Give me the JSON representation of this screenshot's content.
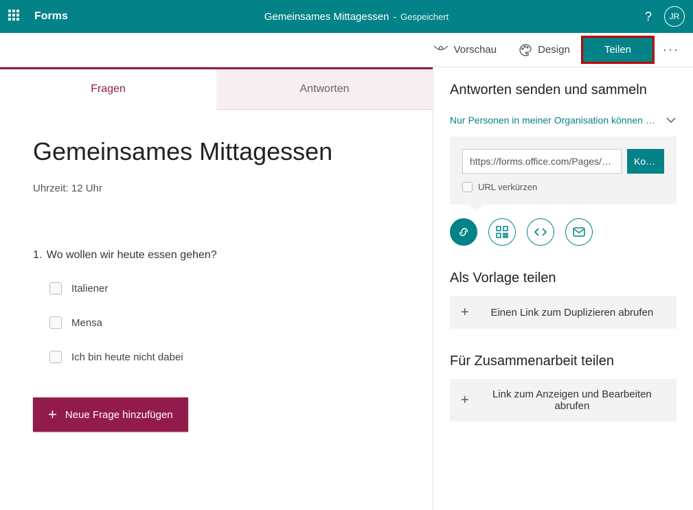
{
  "header": {
    "app_name": "Forms",
    "form_name": "Gemeinsames Mittagessen",
    "save_status": "Gespeichert",
    "user_initials": "JR"
  },
  "commands": {
    "preview": "Vorschau",
    "design": "Design",
    "share": "Teilen"
  },
  "tabs": {
    "questions": "Fragen",
    "responses": "Antworten"
  },
  "form": {
    "title": "Gemeinsames Mittagessen",
    "subtitle": "Uhrzeit: 12 Uhr",
    "questions": [
      {
        "number": "1.",
        "text": "Wo wollen wir heute essen gehen?",
        "options": [
          "Italiener",
          "Mensa",
          "Ich bin heute nicht dabei"
        ]
      }
    ],
    "add_button": "Neue Frage hinzufügen"
  },
  "share_panel": {
    "heading": "Antworten senden und sammeln",
    "audience": "Nur Personen in meiner Organisation können ant...",
    "link_value": "https://forms.office.com/Pages/Respon",
    "copy_label": "Kopie...",
    "shorten_label": "URL verkürzen",
    "template_heading": "Als Vorlage teilen",
    "template_button": "Einen Link zum Duplizieren abrufen",
    "collab_heading": "Für Zusammenarbeit teilen",
    "collab_button": "Link zum Anzeigen und Bearbeiten abrufen"
  }
}
